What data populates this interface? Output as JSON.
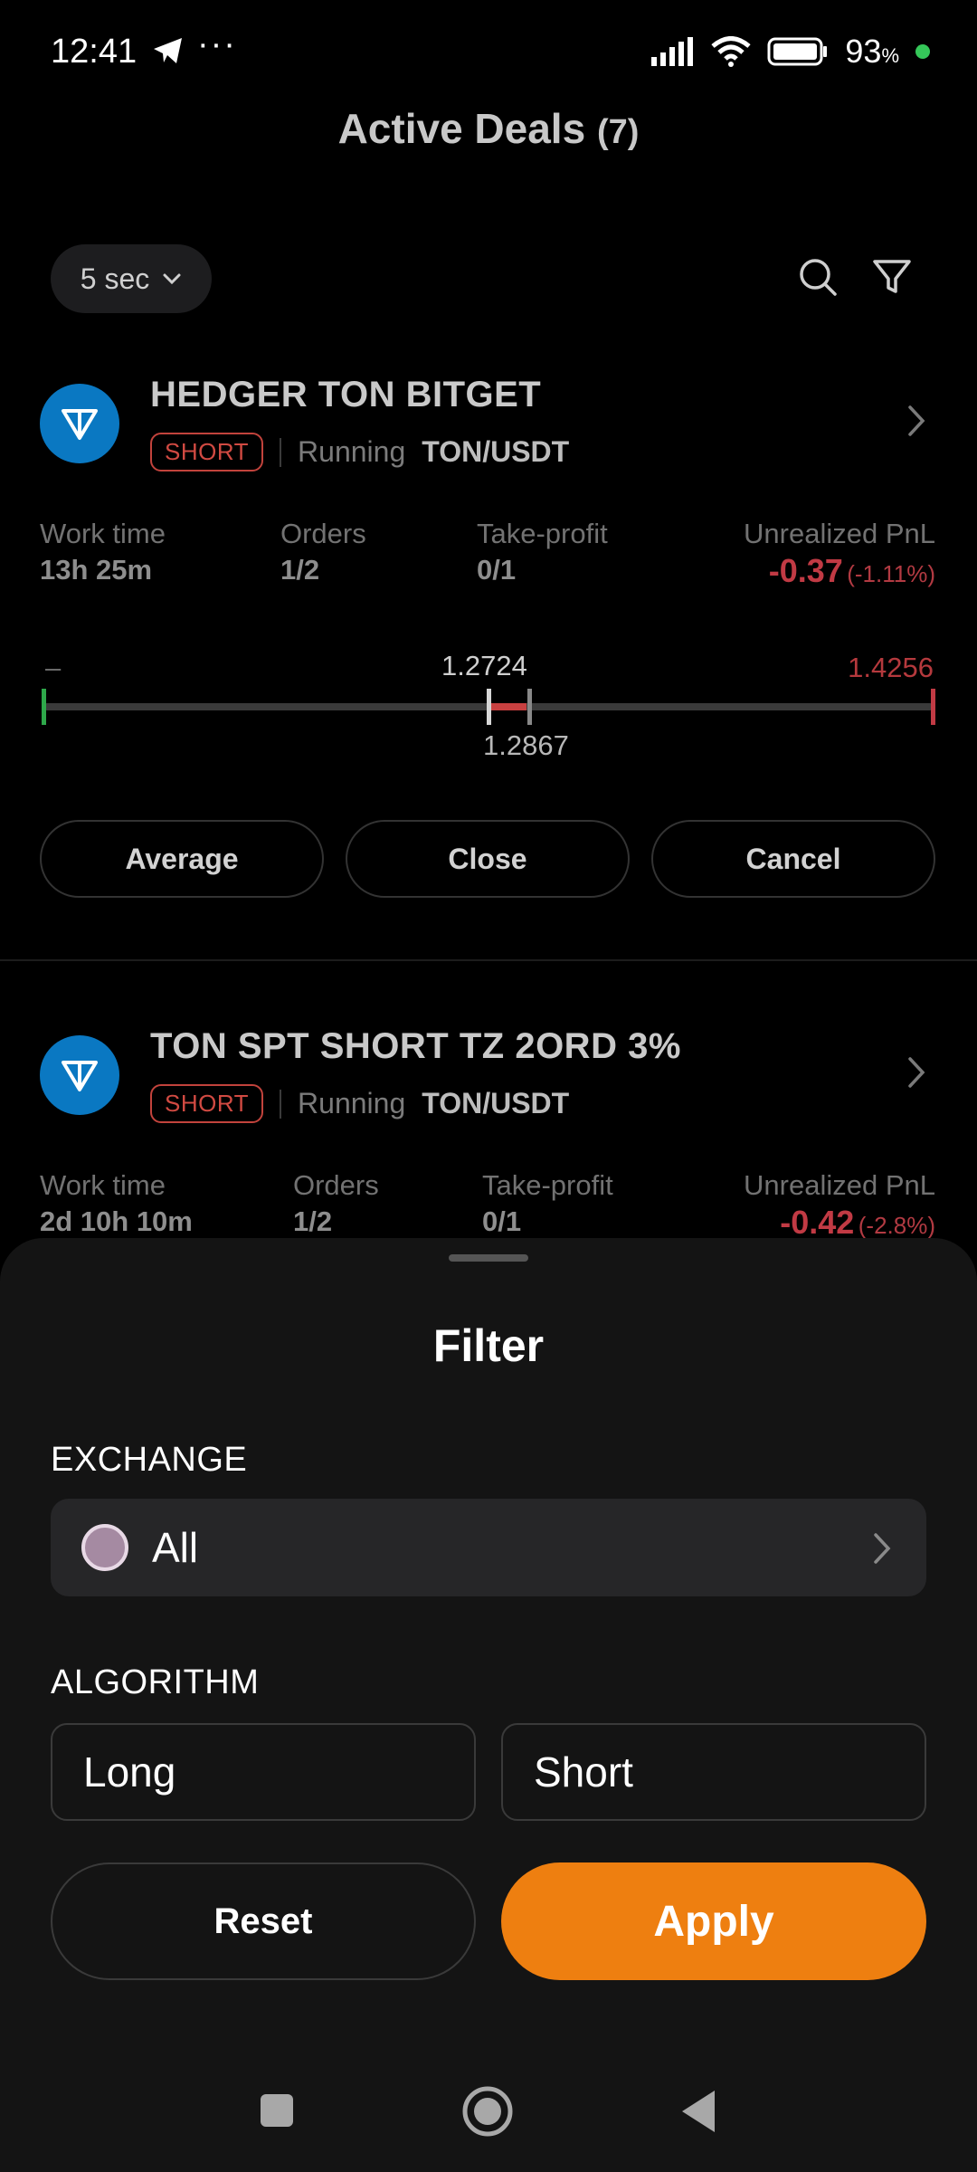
{
  "status_bar": {
    "time": "12:41",
    "battery_percent": "93",
    "battery_unit": "%"
  },
  "header": {
    "title": "Active Deals",
    "count": "(7)"
  },
  "toolbar": {
    "refresh_label": "5 sec",
    "search_icon": "search-icon",
    "filter_icon": "filter-icon"
  },
  "deals": [
    {
      "name": "HEDGER TON BITGET",
      "side": "SHORT",
      "status": "Running",
      "pair": "TON/USDT",
      "work_time_label": "Work time",
      "work_time": "13h 25m",
      "orders_label": "Orders",
      "orders": "1/2",
      "take_profit_label": "Take-profit",
      "take_profit": "0/1",
      "pnl_label": "Unrealized PnL",
      "pnl_value": "-0.37",
      "pnl_pct": "(-1.11%)",
      "price_left": "–",
      "price_entry": "1.2724",
      "price_current": "1.2867",
      "price_stop": "1.4256",
      "actions": [
        "Average",
        "Close",
        "Cancel"
      ]
    },
    {
      "name": "TON SPT SHORT TZ 2ORD 3%",
      "side": "SHORT",
      "status": "Running",
      "pair": "TON/USDT",
      "work_time_label": "Work time",
      "work_time": "2d 10h 10m",
      "orders_label": "Orders",
      "orders": "1/2",
      "take_profit_label": "Take-profit",
      "take_profit": "0/1",
      "pnl_label": "Unrealized PnL",
      "pnl_value": "-0.42",
      "pnl_pct": "(-2.8%)"
    }
  ],
  "filter": {
    "title": "Filter",
    "exchange_label": "EXCHANGE",
    "exchange_value": "All",
    "algorithm_label": "ALGORITHM",
    "algorithm_options": [
      "Long",
      "Short"
    ],
    "reset_label": "Reset",
    "apply_label": "Apply"
  },
  "colors": {
    "accent": "#ee7f10",
    "negative": "#c13a44",
    "ton_blue": "#0a78c2"
  }
}
